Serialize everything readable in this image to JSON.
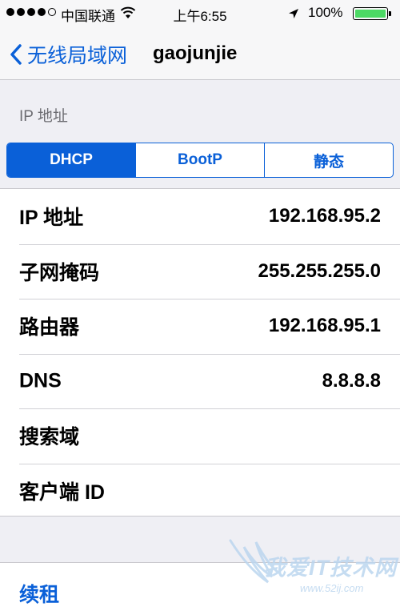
{
  "status_bar": {
    "carrier": "中国联通",
    "time": "上午6:55",
    "battery": "100%",
    "battery_level": 1.0,
    "signal_bars_filled": 4,
    "signal_bars_total": 5,
    "wifi_icon": "wifi-icon",
    "location_icon": "location-arrow-icon"
  },
  "nav": {
    "back_label": "无线局域网",
    "back_icon": "chevron-left-icon",
    "title": "gaojunjie"
  },
  "section": {
    "header": "IP 地址"
  },
  "segments": [
    {
      "label": "DHCP",
      "selected": true
    },
    {
      "label": "BootP",
      "selected": false
    },
    {
      "label": "静态",
      "selected": false
    }
  ],
  "fields": [
    {
      "label": "IP 地址",
      "value": "192.168.95.2"
    },
    {
      "label": "子网掩码",
      "value": "255.255.255.0"
    },
    {
      "label": "路由器",
      "value": "192.168.95.1"
    },
    {
      "label": "DNS",
      "value": "8.8.8.8"
    },
    {
      "label": "搜索域",
      "value": ""
    },
    {
      "label": "客户端 ID",
      "value": ""
    }
  ],
  "renew": {
    "label": "续租"
  },
  "watermark": {
    "text": "我爱IT技术网",
    "url": "www.52ij.com"
  },
  "colors": {
    "accent": "#0a60d8",
    "background": "#efeff4",
    "battery_fill": "#4cd964"
  }
}
